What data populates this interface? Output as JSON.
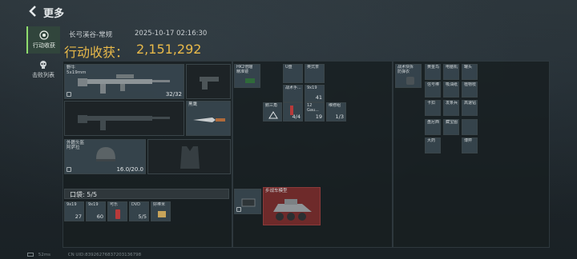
{
  "header": {
    "title": "更多"
  },
  "sidebar": {
    "tabs": [
      {
        "label": "行动收获",
        "active": true
      },
      {
        "label": "击败列表",
        "active": false
      }
    ]
  },
  "summary": {
    "map": "长弓溪谷-常规",
    "datetime": "2025-10-17 02:16:30",
    "loot_label": "行动收获：",
    "loot_value": "2,151,292"
  },
  "equipment": {
    "primary_weapon": {
      "name": "野牛",
      "caliber": "5x19mm",
      "ammo": "32/32"
    },
    "melee": {
      "name": "黑鹰"
    },
    "helmet": {
      "name": "外籍头盔\n阿萨拉",
      "durability": "16.0/20.0"
    }
  },
  "pouch": {
    "label": "口袋: 5/5"
  },
  "pouch_items": [
    {
      "name": "9x19",
      "count": "27"
    },
    {
      "name": "9x19",
      "count": "60"
    },
    {
      "name": "可乐",
      "count": ""
    },
    {
      "name": "DVD",
      "count": "5/5"
    },
    {
      "name": "好棒米",
      "count": ""
    }
  ],
  "rig_items": [
    {
      "name": "HK2倍瞄\n精准镜",
      "count": ""
    },
    {
      "name": "U盘",
      "count": ""
    },
    {
      "name": "英式茶",
      "count": ""
    },
    {
      "name": "战术手...",
      "count": ""
    },
    {
      "name": "9x19",
      "count": "41"
    },
    {
      "name": "鹅三角",
      "count": ""
    },
    {
      "name": "",
      "count": "4/4"
    },
    {
      "name": "12 Gau...",
      "count": "19"
    },
    {
      "name": "维修组",
      "count": "1/3"
    }
  ],
  "backpack_left": [
    {
      "name": "战术快拆\n防弹衣",
      "count": ""
    }
  ],
  "backpack_items": [
    {
      "name": "黄金鸟",
      "count": ""
    },
    {
      "name": "电脑机",
      "count": ""
    },
    {
      "name": "罐头",
      "count": ""
    },
    {
      "name": "信号棒",
      "count": ""
    },
    {
      "name": "吸油纸",
      "count": ""
    },
    {
      "name": "植物枝",
      "count": ""
    },
    {
      "name": "卡扣",
      "count": ""
    },
    {
      "name": "发条兵",
      "count": ""
    },
    {
      "name": "高速钻",
      "count": ""
    },
    {
      "name": "盘尼西",
      "count": ""
    },
    {
      "name": "藏宝图",
      "count": ""
    },
    {
      "name": "大药",
      "count": ""
    },
    {
      "name": "博弈",
      "count": ""
    },
    {
      "name": "",
      "count": ""
    }
  ],
  "vehicle_slot": {
    "name": "步战车模型"
  },
  "footer": {
    "ping": "52ms",
    "uid": "CN UID:83926276837203136798"
  },
  "colors": {
    "accent_gold": "#e8b94a",
    "active_green": "#8fdc6e",
    "vehicle_red": "#6e2a2a"
  }
}
